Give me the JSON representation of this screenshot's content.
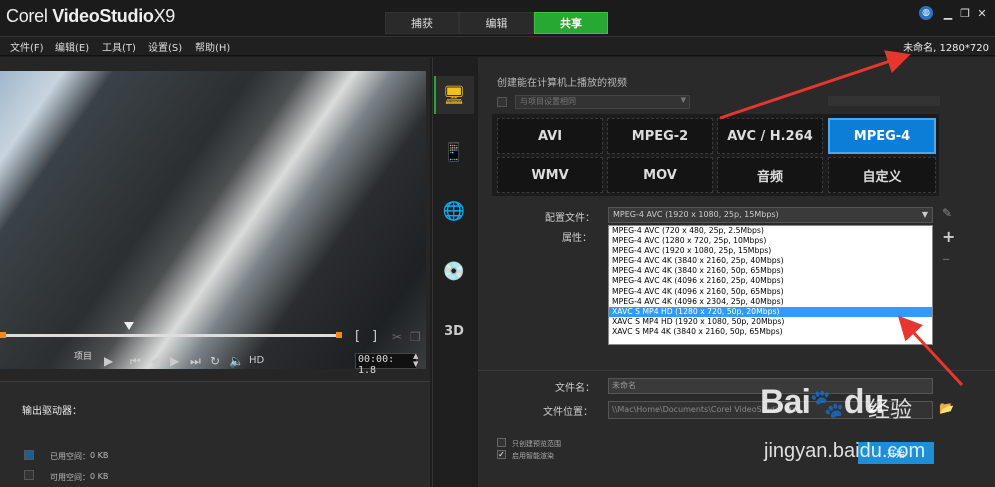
{
  "app": {
    "brand_prefix": "Corel",
    "brand_name": "VideoStudio",
    "brand_version": "X9"
  },
  "top_tabs": [
    {
      "label": "捕获"
    },
    {
      "label": "编辑"
    },
    {
      "label": "共享"
    }
  ],
  "menu": [
    "文件(F)",
    "编辑(E)",
    "工具(T)",
    "设置(S)",
    "帮助(H)"
  ],
  "project_info": "未命名, 1280*720",
  "player": {
    "project_label": "项目",
    "hd_label": "HD",
    "timecode": "00:00: 1.8",
    "bracket_in": "[",
    "bracket_out": "]"
  },
  "drive": {
    "title": "输出驱动器：",
    "used_label": "已用空间：",
    "used_value": "0 KB",
    "free_label": "可用空间：",
    "free_value": "0 KB",
    "used_color": "#1f5f8f",
    "free_color": "#333333"
  },
  "share": {
    "heading": "创建能在计算机上播放的视频",
    "same_as_project": "与项目设置相同",
    "formats": [
      "AVI",
      "MPEG-2",
      "AVC / H.264",
      "MPEG-4",
      "WMV",
      "MOV",
      "音频",
      "自定义"
    ],
    "selected_format": "MPEG-4",
    "profile_label": "配置文件：",
    "attributes_label": "属性：",
    "profile_value": "MPEG-4 AVC (1920 x 1080, 25p, 15Mbps)",
    "profile_options": [
      "MPEG-4 AVC (720 x 480, 25p, 2.5Mbps)",
      "MPEG-4 AVC (1280 x 720, 25p, 10Mbps)",
      "MPEG-4 AVC (1920 x 1080, 25p, 15Mbps)",
      "MPEG-4 AVC 4K (3840 x 2160, 25p, 40Mbps)",
      "MPEG-4 AVC 4K (3840 x 2160, 50p, 65Mbps)",
      "MPEG-4 AVC 4K (4096 x 2160, 25p, 40Mbps)",
      "MPEG-4 AVC 4K (4096 x 2160, 50p, 65Mbps)",
      "MPEG-4 AVC 4K (4096 x 2304, 25p, 40Mbps)",
      "XAVC S MP4 HD (1280 x 720, 50p, 20Mbps)",
      "XAVC S MP4 HD (1920 x 1080, 50p, 20Mbps)",
      "XAVC S MP4 4K (3840 x 2160, 50p, 65Mbps)"
    ],
    "highlighted_option": "XAVC S MP4 HD (1280 x 720, 50p, 20Mbps)",
    "filename_label": "文件名：",
    "filename_value": "未命名",
    "filepath_label": "文件位置：",
    "filepath_value": "\\\\Mac\\Home\\Documents\\Corel VideoStudio Pro\\",
    "check_render_region": "只创建预览范围",
    "check_smart_render": "启用智能渲染",
    "start_label": "开始"
  },
  "watermark": {
    "logo": "Bai",
    "logo_suffix": "du",
    "brand_cn": "经验",
    "url": "jingyan.baidu.com"
  },
  "colors": {
    "accent_green": "#26a833",
    "accent_blue": "#0d7ed8",
    "annotation_red": "#e8352f"
  }
}
